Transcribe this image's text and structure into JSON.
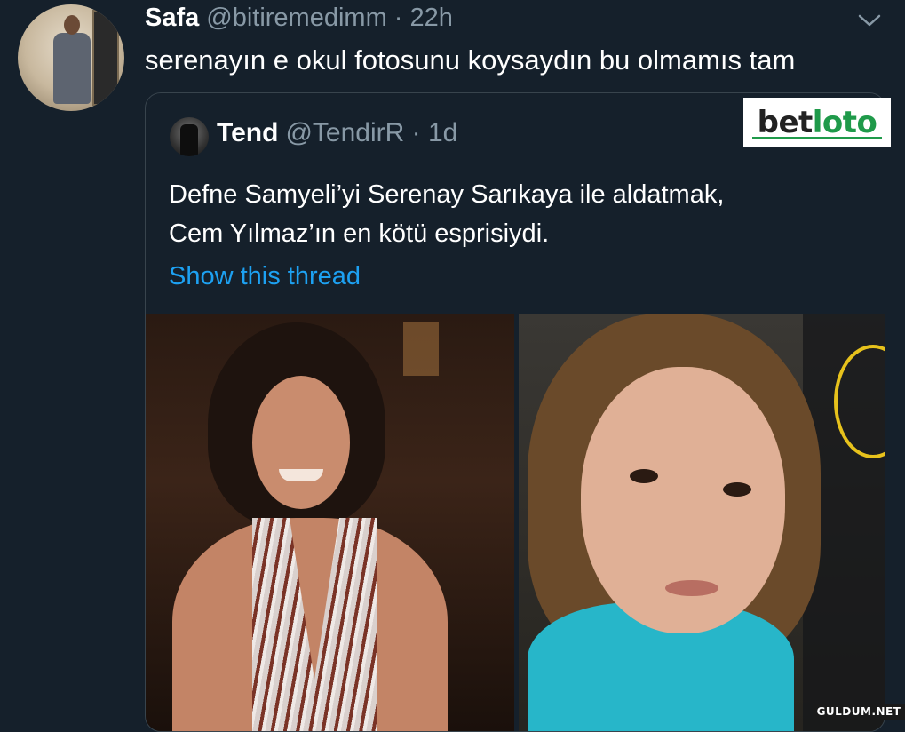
{
  "tweet": {
    "author_name": "Safa",
    "author_handle": "@bitiremedimm",
    "time_sep": " · ",
    "time": "22h",
    "text": "serenayın e okul fotosunu koysaydın bu olmamıs tam"
  },
  "quoted_tweet": {
    "author_name": "Tend",
    "author_handle": "@TendirR",
    "time_sep": " · ",
    "time": "1d",
    "text_line1": "Defne Samyeli’yi Serenay Sarıkaya ile aldatmak,",
    "text_line2": "Cem Yılmaz’ın en kötü esprisiydi.",
    "show_thread": "Show this thread"
  },
  "overlay": {
    "logo_bet": "bet",
    "logo_loto": "loto",
    "watermark": "GULDUM.NET"
  },
  "colors": {
    "background": "#15202b",
    "text_secondary": "#8899a6",
    "link": "#1da1f2",
    "border": "#38444d"
  },
  "icons": {
    "menu": "chevron-down-icon"
  }
}
